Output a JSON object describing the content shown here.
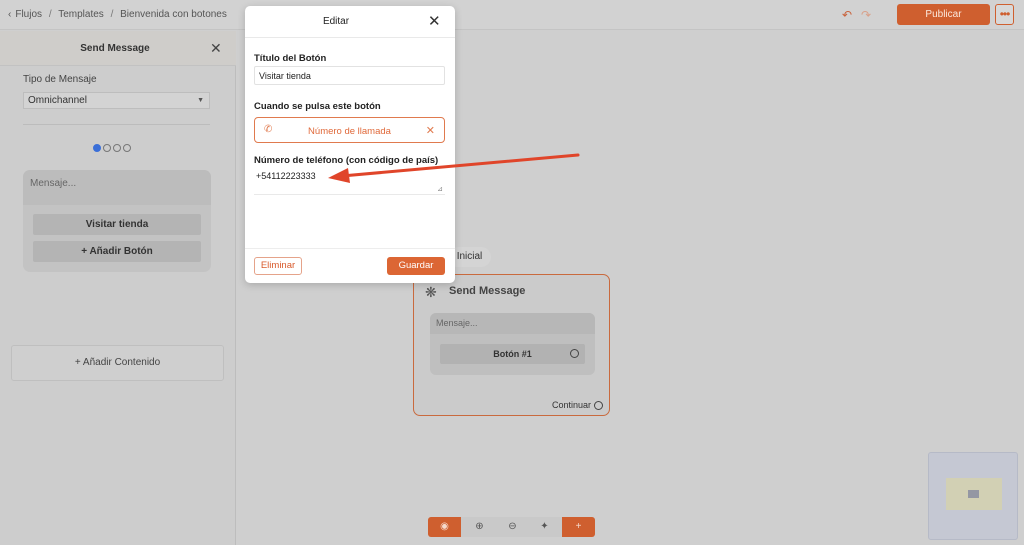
{
  "topbar": {
    "breadcrumb": [
      "Flujos",
      "Templates",
      "Bienvenida con botones"
    ],
    "publish_label": "Publicar",
    "more_label": "•••"
  },
  "left_panel": {
    "title": "Send Message",
    "message_type_label": "Tipo de Mensaje",
    "message_type_value": "Omnichannel",
    "message_placeholder": "Mensaje...",
    "buttons": [
      "Visitar tienda",
      "+ Añadir Botón"
    ],
    "add_content_label": "+ Añadir Contenido"
  },
  "canvas": {
    "start_label": "Inicial",
    "node": {
      "title": "Send Message",
      "message_placeholder": "Mensaje...",
      "button_label": "Botón #1",
      "continue_label": "Continuar"
    }
  },
  "modal": {
    "title": "Editar",
    "button_title_label": "Título del Botón",
    "button_title_value": "Visitar tienda",
    "when_pressed_label": "Cuando se pulsa este botón",
    "action_label": "Número de llamada",
    "phone_label": "Número de teléfono (con código de país)",
    "phone_value": "+54112223333",
    "delete_label": "Eliminar",
    "save_label": "Guardar"
  },
  "colors": {
    "accent": "#cf5f2f",
    "annotation_arrow": "#e0452a"
  },
  "icons": [
    "chevron-left-icon",
    "undo-icon",
    "redo-icon",
    "close-icon",
    "messenger-icon",
    "whatsapp-icon",
    "instagram-icon",
    "chat-icon",
    "openai-icon",
    "phone-icon",
    "eye-icon",
    "zoom-in-icon",
    "zoom-out-icon",
    "magic-icon",
    "plus-icon"
  ]
}
